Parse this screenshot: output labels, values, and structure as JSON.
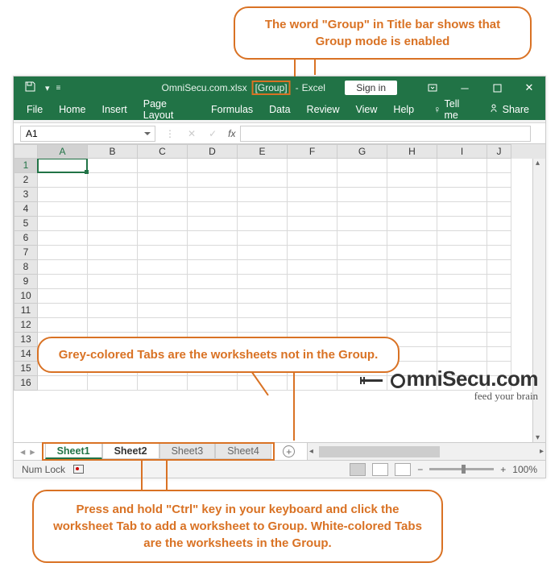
{
  "callouts": {
    "top": "The word \"Group\" in Title bar shows that Group mode is enabled",
    "mid": "Grey-colored Tabs are the worksheets not in the Group.",
    "bot": "Press and hold \"Ctrl\" key in your keyboard and click the worksheet Tab to add a worksheet to Group. White-colored Tabs are the worksheets in the Group."
  },
  "titlebar": {
    "filename": "OmniSecu.com.xlsx",
    "group": "[Group]",
    "app": "Excel",
    "signin": "Sign in"
  },
  "ribbon": {
    "file": "File",
    "tabs": [
      "Home",
      "Insert",
      "Page Layout",
      "Formulas",
      "Data",
      "Review",
      "View",
      "Help"
    ],
    "tellme": "Tell me",
    "share": "Share"
  },
  "namebox": "A1",
  "fx": "fx",
  "columns": [
    "A",
    "B",
    "C",
    "D",
    "E",
    "F",
    "G",
    "H",
    "I",
    "J"
  ],
  "rows": [
    "1",
    "2",
    "3",
    "4",
    "5",
    "6",
    "7",
    "8",
    "9",
    "10",
    "11",
    "12",
    "13",
    "14",
    "15",
    "16"
  ],
  "sheets": [
    {
      "name": "Sheet1",
      "state": "active"
    },
    {
      "name": "Sheet2",
      "state": "ingroup"
    },
    {
      "name": "Sheet3",
      "state": "out"
    },
    {
      "name": "Sheet4",
      "state": "out"
    }
  ],
  "status": {
    "numlock": "Num Lock",
    "zoom": "100%"
  },
  "logo": {
    "main": "mniSecu.com",
    "sub": "feed your brain"
  }
}
